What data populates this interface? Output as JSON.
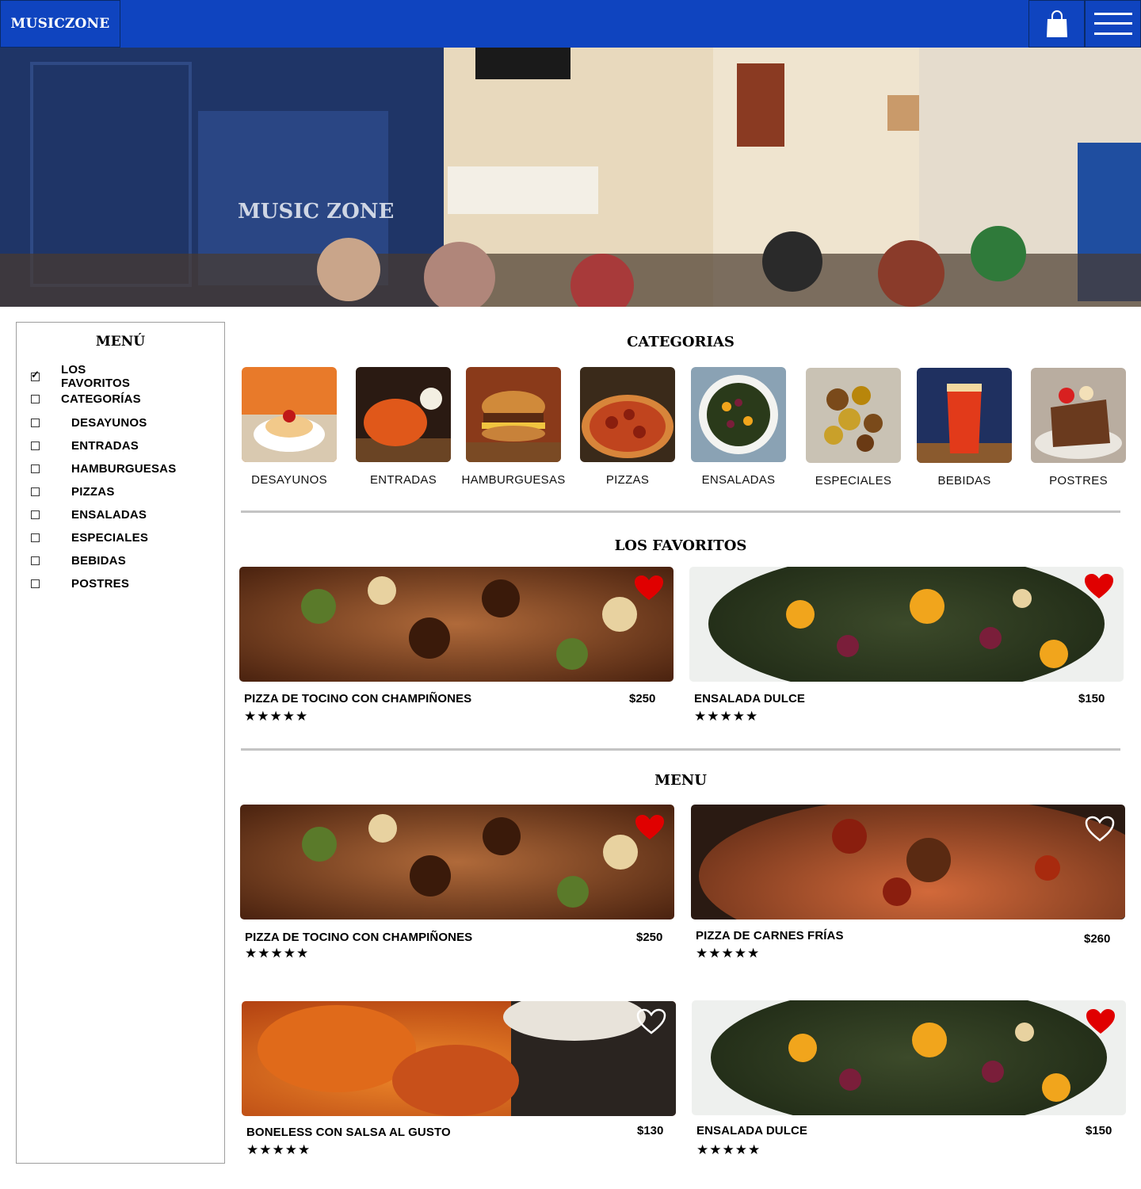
{
  "header": {
    "logo": "MUSICZONE",
    "icons": [
      "shopping-bag-icon",
      "hamburger-menu-icon"
    ],
    "color": "#0f44bf"
  },
  "sidebar": {
    "title": "MENÚ",
    "items": [
      {
        "label": "LOS FAVORITOS",
        "checked": true
      },
      {
        "label": "CATEGORÍAS",
        "checked": false
      },
      {
        "label": "DESAYUNOS",
        "checked": false
      },
      {
        "label": "ENTRADAS",
        "checked": false
      },
      {
        "label": "HAMBURGUESAS",
        "checked": false
      },
      {
        "label": "PIZZAS",
        "checked": false
      },
      {
        "label": "ENSALADAS",
        "checked": false
      },
      {
        "label": "ESPECIALES",
        "checked": false
      },
      {
        "label": "BEBIDAS",
        "checked": false
      },
      {
        "label": "POSTRES",
        "checked": false
      }
    ]
  },
  "categories": {
    "title": "CATEGORIAS",
    "items": [
      "DESAYUNOS",
      "ENTRADAS",
      "HAMBURGUESAS",
      "PIZZAS",
      "ENSALADAS",
      "ESPECIALES",
      "BEBIDAS",
      "POSTRES"
    ]
  },
  "favorites": {
    "title": "LOS FAVORITOS",
    "items": [
      {
        "name": "PIZZA DE TOCINO CON CHAMPIÑONES",
        "price": "$250",
        "stars": "★★★★★",
        "favorite": true
      },
      {
        "name": "ENSALADA DULCE",
        "price": "$150",
        "stars": "★★★★★",
        "favorite": true
      }
    ]
  },
  "menu": {
    "title": "MENU",
    "items": [
      {
        "name": "PIZZA DE TOCINO CON CHAMPIÑONES",
        "price": "$250",
        "stars": "★★★★★",
        "favorite": true
      },
      {
        "name": "PIZZA DE CARNES FRÍAS",
        "price": "$260",
        "stars": "★★★★★",
        "favorite": false
      },
      {
        "name": "BONELESS CON SALSA AL GUSTO",
        "price": "$130",
        "stars": "★★★★★",
        "favorite": false
      },
      {
        "name": "ENSALADA DULCE",
        "price": "$150",
        "stars": "★★★★★",
        "favorite": true
      }
    ]
  },
  "colors": {
    "brand": "#0f44bf",
    "heart": "#e00000",
    "divider": "#c4c4c4"
  }
}
